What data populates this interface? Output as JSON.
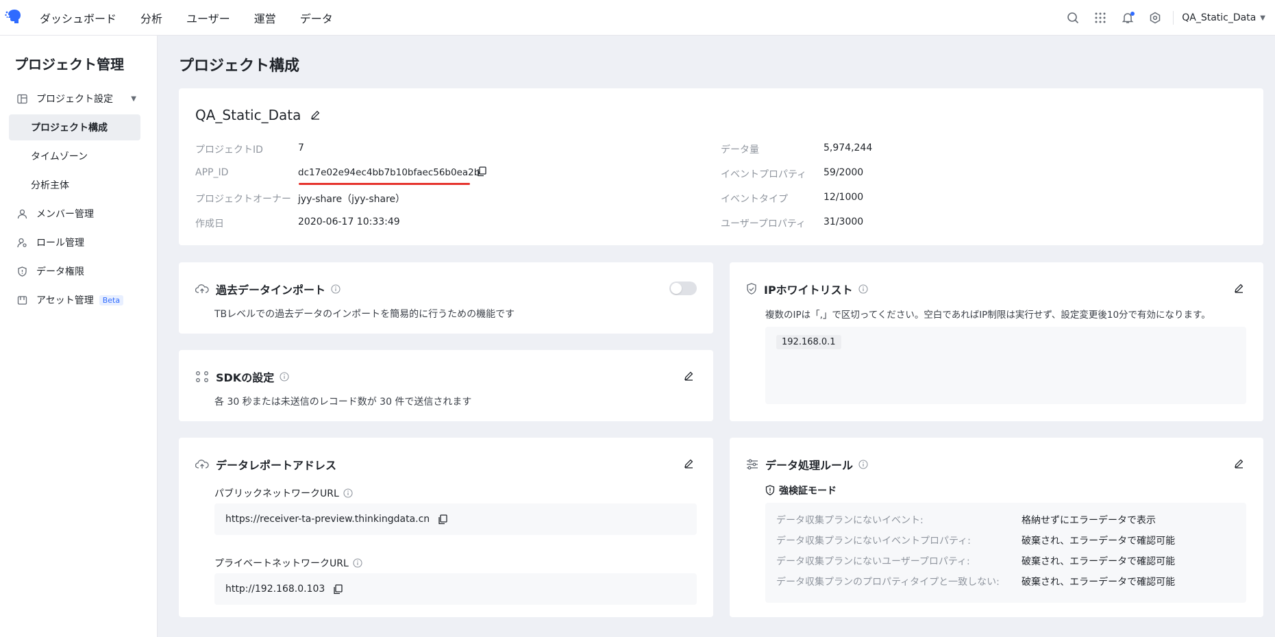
{
  "topbar": {
    "nav": [
      "ダッシュボード",
      "分析",
      "ユーザー",
      "運営",
      "データ"
    ],
    "user": "QA_Static_Data",
    "accent_color": "#2f6bff"
  },
  "sidebar": {
    "title": "プロジェクト管理",
    "items": [
      {
        "label": "プロジェクト設定",
        "icon": "layout-icon"
      },
      {
        "label": "プロジェクト構成"
      },
      {
        "label": "タイムゾーン"
      },
      {
        "label": "分析主体"
      },
      {
        "label": "メンバー管理",
        "icon": "user-icon"
      },
      {
        "label": "ロール管理",
        "icon": "user-key-icon"
      },
      {
        "label": "データ権限",
        "icon": "shield-icon"
      },
      {
        "label": "アセット管理",
        "icon": "asset-icon",
        "badge": "Beta"
      }
    ]
  },
  "page": {
    "title": "プロジェクト構成"
  },
  "project": {
    "name": "QA_Static_Data",
    "left": [
      {
        "label": "プロジェクトID",
        "value": "7"
      },
      {
        "label": "APP_ID",
        "value": "dc17e02e94ec4bb7b10bfaec56b0ea2b"
      },
      {
        "label": "プロジェクトオーナー",
        "value": "jyy-share（jyy-share）"
      },
      {
        "label": "作成日",
        "value": "2020-06-17 10:33:49"
      }
    ],
    "right": [
      {
        "label": "データ量",
        "value": "5,974,244"
      },
      {
        "label": "イベントプロパティ",
        "value": "59/2000"
      },
      {
        "label": "イベントタイプ",
        "value": "12/1000"
      },
      {
        "label": "ユーザープロパティ",
        "value": "31/3000"
      }
    ]
  },
  "history_import": {
    "title": "過去データインポート",
    "desc": "TBレベルでの過去データのインポートを簡易的に行うための機能です",
    "enabled": false
  },
  "sdk": {
    "title": "SDKの設定",
    "desc": "各 30 秒または未送信のレコード数が 30 件で送信されます"
  },
  "ip_whitelist": {
    "title": "IPホワイトリスト",
    "desc": "複数のIPは「,」で区切ってください。空白であればIP制限は実行せず、設定変更後10分で有効になります。",
    "ips": [
      "192.168.0.1"
    ]
  },
  "report": {
    "title": "データレポートアドレス",
    "public_label": "パブリックネットワークURL",
    "public_url": "https://receiver-ta-preview.thinkingdata.cn",
    "private_label": "プライベートネットワークURL",
    "private_url": "http://192.168.0.103"
  },
  "rules": {
    "title": "データ処理ルール",
    "mode": "強検証モード",
    "rows": [
      {
        "key": "データ収集プランにないイベント:",
        "value": "格納せずにエラーデータで表示"
      },
      {
        "key": "データ収集プランにないイベントプロパティ:",
        "value": "破棄され、エラーデータで確認可能"
      },
      {
        "key": "データ収集プランにないユーザープロパティ:",
        "value": "破棄され、エラーデータで確認可能"
      },
      {
        "key": "データ収集プランのプロパティタイプと一致しない:",
        "value": "破棄され、エラーデータで確認可能"
      }
    ]
  }
}
